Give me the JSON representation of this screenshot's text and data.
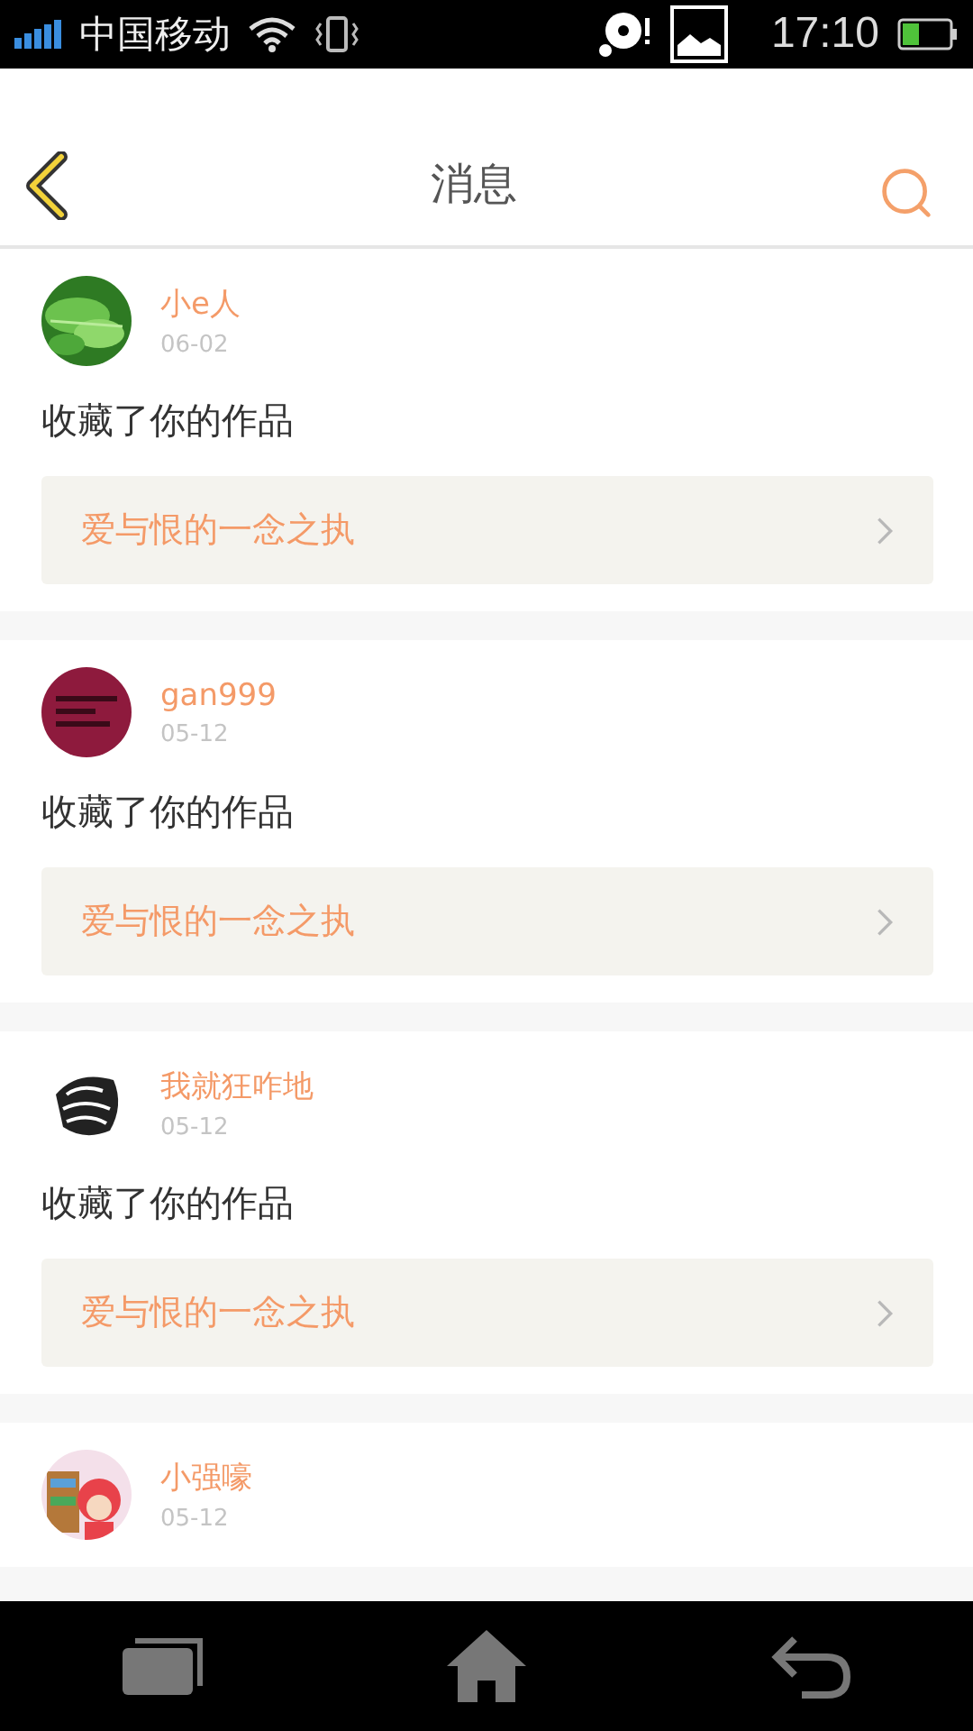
{
  "status_bar": {
    "carrier": "中国移动",
    "time": "17:10"
  },
  "header": {
    "title": "消息"
  },
  "messages": [
    {
      "user": "小e人",
      "date": "06-02",
      "action": "收藏了你的作品",
      "work": "爱与恨的一念之执"
    },
    {
      "user": "gan999",
      "date": "05-12",
      "action": "收藏了你的作品",
      "work": "爱与恨的一念之执"
    },
    {
      "user": "我就狂咋地",
      "date": "05-12",
      "action": "收藏了你的作品",
      "work": "爱与恨的一念之执"
    },
    {
      "user": "小强嚎",
      "date": "05-12"
    }
  ]
}
